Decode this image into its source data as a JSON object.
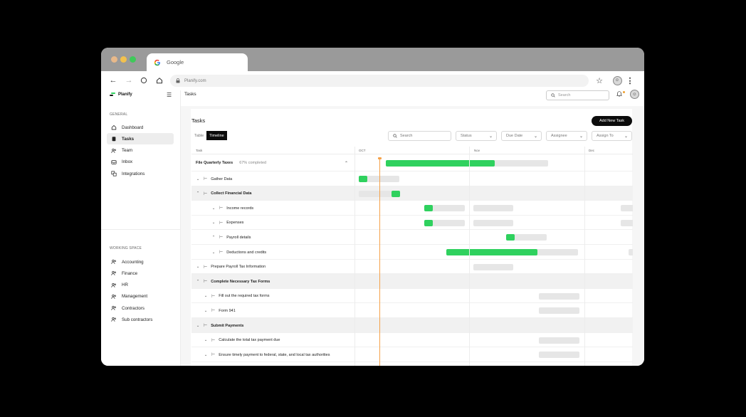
{
  "colors": {
    "accent": "#2fd15e",
    "today": "#f5a24a",
    "dark": "#0c0c0c"
  },
  "browser": {
    "tab_title": "Google",
    "url": "Planify.com",
    "icons": [
      "back-arrow-icon",
      "forward-arrow-icon",
      "reload-icon",
      "home-icon",
      "lock-icon",
      "star-icon",
      "profile-icon",
      "kebab-menu-icon"
    ]
  },
  "app": {
    "name": "Planify",
    "page_title": "Tasks",
    "search_placeholder": "Search"
  },
  "sidebar": {
    "general_label": "GENERAL",
    "general_items": [
      {
        "label": "Dashboard",
        "icon": "home-icon",
        "active": false
      },
      {
        "label": "Tasks",
        "icon": "clipboard-icon",
        "active": true
      },
      {
        "label": "Team",
        "icon": "team-icon",
        "active": false
      },
      {
        "label": "Inbox",
        "icon": "inbox-icon",
        "active": false
      },
      {
        "label": "Integrations",
        "icon": "integrations-icon",
        "active": false
      }
    ],
    "workspace_label": "WORKING SPACE",
    "workspace_items": [
      {
        "label": "Accounting",
        "icon": "users-icon"
      },
      {
        "label": "Finance",
        "icon": "users-icon"
      },
      {
        "label": "HR",
        "icon": "users-icon"
      },
      {
        "label": "Management",
        "icon": "users-icon"
      },
      {
        "label": "Contractors",
        "icon": "users-icon"
      },
      {
        "label": "Sub contractors",
        "icon": "users-icon"
      }
    ]
  },
  "tasks": {
    "title": "Tasks",
    "add_button": "Add New Task",
    "views": [
      "Table",
      "Timeline"
    ],
    "active_view": "Timeline",
    "search_placeholder": "Search",
    "filters": [
      "Status",
      "Due Date",
      "Assignee",
      "Assign To"
    ],
    "columns": {
      "task": "Task",
      "months": [
        "OCT",
        "Nov",
        "Dec"
      ]
    },
    "rows": [
      {
        "label": "File Quarterly Taxes",
        "meta": "67% completed",
        "progress": 0.67
      },
      {
        "label": "Gather Data"
      },
      {
        "label": "Collect Financial Data"
      },
      {
        "label": "Income records"
      },
      {
        "label": "Expenses"
      },
      {
        "label": "Payroll details"
      },
      {
        "label": "Deductions and credits"
      },
      {
        "label": "Prepare Payroll Tax Information"
      },
      {
        "label": "Complete Necessary Tax Forms"
      },
      {
        "label": "Fill out the required tax forms"
      },
      {
        "label": "Form 941"
      },
      {
        "label": "Submit Payments"
      },
      {
        "label": "Calculate the total tax payment due"
      },
      {
        "label": "Ensure timely payment to federal, state, and local tax authorities"
      }
    ]
  }
}
